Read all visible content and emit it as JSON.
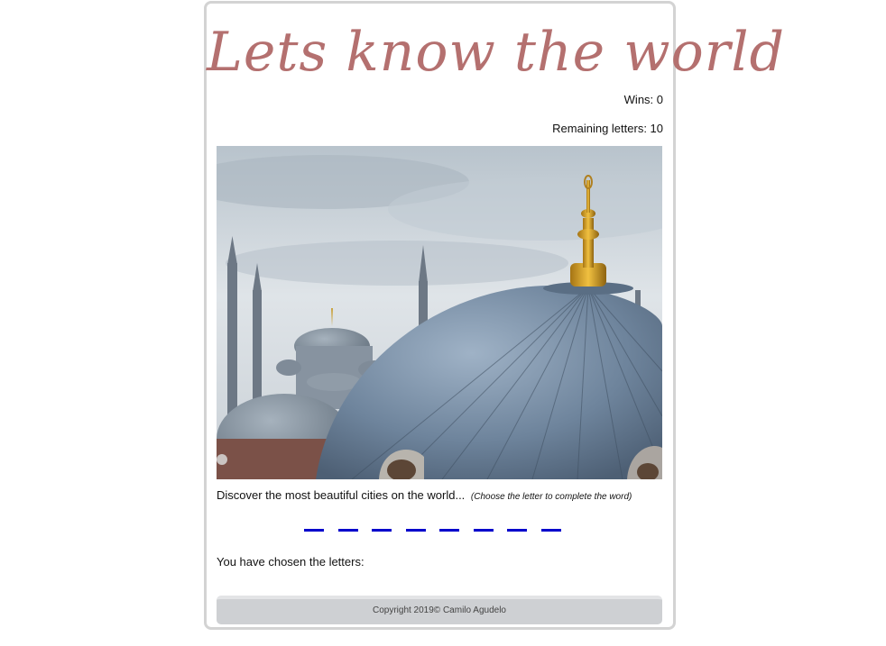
{
  "header": {
    "title": "Lets know the world",
    "wins_text": "Wins: 0",
    "remaining_text": "Remaining letters: 10"
  },
  "game": {
    "caption": "Discover the most beautiful cities on the world...",
    "hint": "(Choose the letter to complete the word)",
    "blanks_count": 8,
    "chosen_label": "You have chosen the letters:"
  },
  "footer": {
    "copyright": "Copyright 2019© Camilo Agudelo"
  },
  "colors": {
    "title": "#b4706f",
    "blank": "#0000cc",
    "footer_bg": "#ced0d3"
  }
}
